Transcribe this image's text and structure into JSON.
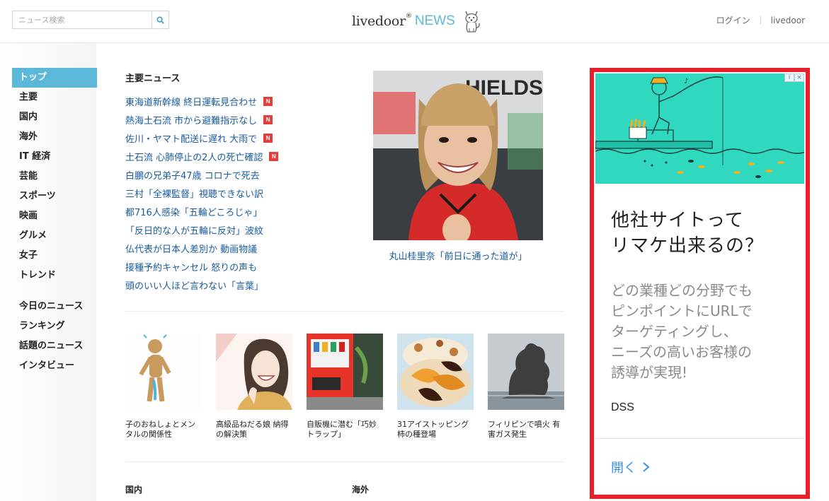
{
  "header": {
    "search_placeholder": "ニュース検索",
    "logo_word": "livedoor",
    "logo_news": "NEWS",
    "login": "ログイン",
    "livedoor_link": "livedoor"
  },
  "sidebar": {
    "primary": [
      "トップ",
      "主要",
      "国内",
      "海外",
      "IT 経済",
      "芸能",
      "スポーツ",
      "映画",
      "グルメ",
      "女子",
      "トレンド"
    ],
    "secondary": [
      "今日のニュース",
      "ランキング",
      "話題のニュース",
      "インタビュー"
    ]
  },
  "main": {
    "section_title": "主要ニュース",
    "headlines": [
      {
        "text": "東海道新幹線 終日運転見合わせ",
        "new": "N"
      },
      {
        "text": "熱海土石流 市から避難指示なし",
        "new": "N"
      },
      {
        "text": "佐川・ヤマト配送に遅れ 大雨で",
        "new": "N"
      },
      {
        "text": "土石流 心肺停止の2人の死亡確認",
        "new": "N"
      },
      {
        "text": "白鵬の兄弟子47歳 コロナで死去",
        "new": ""
      },
      {
        "text": "三村「全裸監督」視聴できない訳",
        "new": ""
      },
      {
        "text": "都716人感染「五輪どころじゃ」",
        "new": ""
      },
      {
        "text": "「反日的な人が五輪に反対」波紋",
        "new": ""
      },
      {
        "text": "仏代表が日本人差別か 動画物議",
        "new": ""
      },
      {
        "text": "接種予約キャンセル 怒りの声も",
        "new": ""
      },
      {
        "text": "頭のいい人ほど言わない「言葉」",
        "new": ""
      }
    ],
    "feature_caption": "丸山桂里奈「前日に通った道が」",
    "feature_backdrop_text": "HIELDS",
    "thumbs": [
      "子のおねしょとメンタルの関係性",
      "高級品ねだる娘 納得の解決策",
      "自販機に潜む「巧妙トラップ」",
      "31アイストッピング 柿の種登場",
      "フィリピンで噴火 有害ガス発生"
    ],
    "bottom_headers": [
      "国内",
      "海外"
    ]
  },
  "ad": {
    "title": "他社サイトって リマケ出来るの？",
    "body": "どの業種どの分野でも ピンポイントにURLで ターゲティングし、 ニーズの高いお客様の 誘導が実現!",
    "brand": "DSS",
    "open_label": "開く",
    "choice_i": "i",
    "choice_x": "×"
  },
  "colors": {
    "accent": "#5bb8d8",
    "link": "#1a5aa0",
    "badge": "#e53c3c",
    "ad_border": "#e8202b",
    "ad_hero": "#2fd8bf",
    "ad_link": "#3a8ee6"
  }
}
